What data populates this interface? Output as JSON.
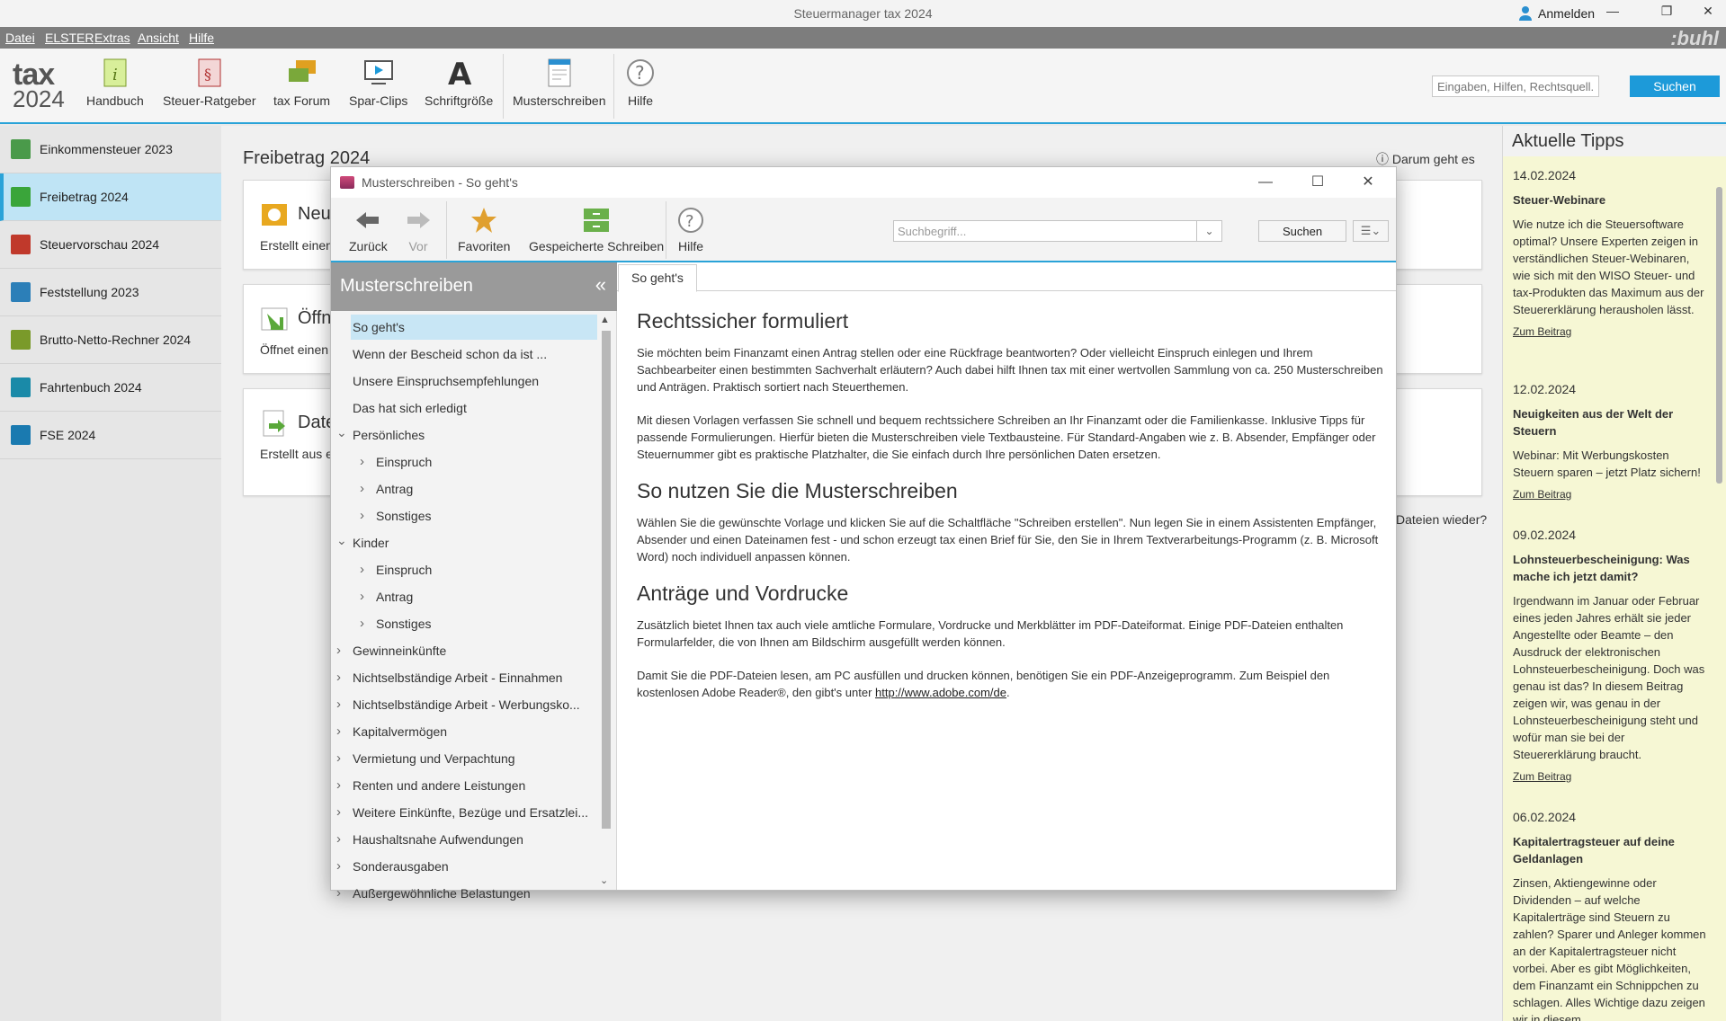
{
  "window": {
    "title": "Steuermanager tax 2024",
    "login_label": "Anmelden"
  },
  "menu": {
    "items": [
      "Datei",
      "ELSTER",
      "Extras",
      "Ansicht",
      "Hilfe"
    ],
    "brand": ":buhl"
  },
  "logo": {
    "line1": "tax",
    "line2": "2024"
  },
  "toolbar": {
    "items": [
      "Handbuch",
      "Steuer-Ratgeber",
      "tax Forum",
      "Spar-Clips",
      "Schriftgröße",
      "Musterschreiben",
      "Hilfe"
    ],
    "search_placeholder": "Eingaben, Hilfen, Rechtsquell...",
    "search_button": "Suchen"
  },
  "sidebar": {
    "items": [
      {
        "label": "Einkommensteuer 2023",
        "color": "#4a9a4a"
      },
      {
        "label": "Freibetrag 2024",
        "color": "#3aa53a"
      },
      {
        "label": "Steuervorschau 2024",
        "color": "#c0392b"
      },
      {
        "label": "Feststellung 2023",
        "color": "#2c7fb8"
      },
      {
        "label": "Brutto-Netto-Rechner 2024",
        "color": "#7a9a2a"
      },
      {
        "label": "Fahrtenbuch 2024",
        "color": "#1a8aa8"
      },
      {
        "label": "FSE 2024",
        "color": "#1a7ab0"
      }
    ]
  },
  "main": {
    "title": "Freibetrag 2024",
    "help_link": "Darum geht es",
    "cards": [
      {
        "title": "Neu",
        "subtitle": "Erstellt einen"
      },
      {
        "title": "Öffn",
        "subtitle": "Öffnet einen"
      },
      {
        "title": "Date",
        "subtitle": "Erstellt aus e"
      }
    ],
    "trailing_text": "Dateien wieder?"
  },
  "tips": {
    "header": "Aktuelle Tipps",
    "items": [
      {
        "date": "14.02.2024",
        "title": "Steuer-Webinare",
        "text": "Wie nutze ich die Steuersoftware optimal? Unsere Experten zeigen in verständlichen Steuer-Webinaren, wie sich mit den WISO Steuer- und tax-Produkten das Maximum aus der Steuererklärung herausholen lässt.",
        "link": "Zum Beitrag"
      },
      {
        "date": "12.02.2024",
        "title": "Neuigkeiten aus der Welt der Steuern",
        "text": "Webinar: Mit Werbungskosten Steuern sparen – jetzt Platz sichern!",
        "link": "Zum Beitrag"
      },
      {
        "date": "09.02.2024",
        "title": "Lohnsteuerbescheinigung: Was mache ich jetzt damit?",
        "text": "Irgendwann im Januar oder Februar eines jeden Jahres erhält sie jeder Angestellte oder Beamte – den Ausdruck der elektronischen Lohnsteuerbescheinigung. Doch was genau ist das? In diesem Beitrag zeigen wir, was genau in der Lohnsteuerbescheinigung steht und wofür man sie bei der Steuererklärung braucht.",
        "link": "Zum Beitrag"
      },
      {
        "date": "06.02.2024",
        "title": "Kapitalertragsteuer auf deine Geldanlagen",
        "text": "Zinsen, Aktiengewinne oder Dividenden – auf welche Kapitalerträge sind Steuern zu zahlen? Sparer und Anleger kommen an der Kapitalertragsteuer nicht vorbei. Aber es gibt Möglichkeiten, dem Finanzamt ein Schnippchen zu schlagen. Alles Wichtige dazu zeigen wir in diesem",
        "link": ""
      }
    ]
  },
  "dialog": {
    "title": "Musterschreiben - So geht's",
    "toolbar": {
      "back": "Zurück",
      "forward": "Vor",
      "favorites": "Favoriten",
      "saved": "Gespeicherte Schreiben",
      "help": "Hilfe",
      "search_placeholder": "Suchbegriff...",
      "search_button": "Suchen"
    },
    "tree": {
      "header": "Musterschreiben",
      "items": [
        {
          "label": "So geht's",
          "level": 0,
          "arrow": "",
          "selected": true
        },
        {
          "label": "Wenn der Bescheid schon da ist ...",
          "level": 0,
          "arrow": ""
        },
        {
          "label": "Unsere Einspruchsempfehlungen",
          "level": 0,
          "arrow": ""
        },
        {
          "label": "Das hat sich erledigt",
          "level": 0,
          "arrow": ""
        },
        {
          "label": "Persönliches",
          "level": 0,
          "arrow": "down"
        },
        {
          "label": "Einspruch",
          "level": 1,
          "arrow": "right"
        },
        {
          "label": "Antrag",
          "level": 1,
          "arrow": "right"
        },
        {
          "label": "Sonstiges",
          "level": 1,
          "arrow": "right"
        },
        {
          "label": "Kinder",
          "level": 0,
          "arrow": "down"
        },
        {
          "label": "Einspruch",
          "level": 1,
          "arrow": "right"
        },
        {
          "label": "Antrag",
          "level": 1,
          "arrow": "right"
        },
        {
          "label": "Sonstiges",
          "level": 1,
          "arrow": "right"
        },
        {
          "label": "Gewinneinkünfte",
          "level": 0,
          "arrow": "right"
        },
        {
          "label": "Nichtselbständige Arbeit - Einnahmen",
          "level": 0,
          "arrow": "right"
        },
        {
          "label": "Nichtselbständige Arbeit - Werbungsko...",
          "level": 0,
          "arrow": "right"
        },
        {
          "label": "Kapitalvermögen",
          "level": 0,
          "arrow": "right"
        },
        {
          "label": "Vermietung und Verpachtung",
          "level": 0,
          "arrow": "right"
        },
        {
          "label": "Renten und andere Leistungen",
          "level": 0,
          "arrow": "right"
        },
        {
          "label": "Weitere Einkünfte, Bezüge und Ersatzlei...",
          "level": 0,
          "arrow": "right"
        },
        {
          "label": "Haushaltsnahe Aufwendungen",
          "level": 0,
          "arrow": "right"
        },
        {
          "label": "Sonderausgaben",
          "level": 0,
          "arrow": "right"
        },
        {
          "label": "Außergewöhnliche Belastungen",
          "level": 0,
          "arrow": "right"
        }
      ]
    },
    "tab": "So geht's",
    "content": {
      "h1": "Rechtssicher formuliert",
      "p1": "Sie möchten beim Finanzamt einen Antrag stellen oder eine Rückfrage beantworten? Oder vielleicht Einspruch einlegen und Ihrem Sachbearbeiter einen bestimmten Sachverhalt erläutern? Auch dabei hilft Ihnen tax mit einer wertvollen Sammlung von ca. 250 Musterschreiben und Anträgen. Praktisch sortiert nach Steuerthemen.",
      "p2": "Mit diesen Vorlagen verfassen Sie schnell und bequem rechtssichere Schreiben an Ihr Finanzamt oder die Familienkasse. Inklusive Tipps für passende Formulierungen. Hierfür bieten die Musterschreiben viele Textbausteine. Für Standard-Angaben wie z. B. Absender, Empfänger oder Steuernummer gibt es praktische Platzhalter, die Sie einfach durch Ihre persönlichen Daten ersetzen.",
      "h2": "So nutzen Sie die Musterschreiben",
      "p3": "Wählen Sie die gewünschte Vorlage und klicken Sie auf die Schaltfläche \"Schreiben erstellen\". Nun legen Sie in einem Assistenten Empfänger, Absender und einen Dateinamen fest - und schon erzeugt tax einen Brief für Sie, den Sie in Ihrem Textverarbeitungs-Programm (z. B. Microsoft Word) noch individuell anpassen können.",
      "h3": "Anträge und Vordrucke",
      "p4": "Zusätzlich bietet Ihnen tax auch viele amtliche Formulare, Vordrucke und Merkblätter im PDF-Dateiformat. Einige PDF-Dateien enthalten Formularfelder, die von Ihnen am Bildschirm ausgefüllt werden können.",
      "p5_prefix": "Damit Sie die PDF-Dateien lesen, am PC ausfüllen und drucken können, benötigen Sie ein PDF-Anzeigeprogramm. Zum Beispiel den kostenlosen Adobe Reader®, den gibt's unter ",
      "p5_link": "http://www.adobe.com/de",
      "p5_suffix": "."
    }
  }
}
